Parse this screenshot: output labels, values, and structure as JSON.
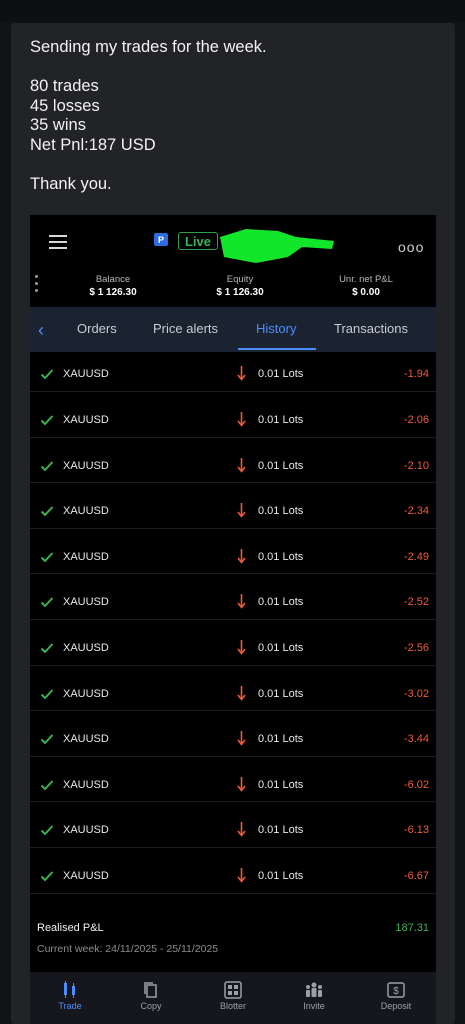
{
  "message": {
    "lines": [
      "Sending my trades for the week.",
      "",
      "80 trades",
      "45 losses",
      "35 wins",
      "Net Pnl:187 USD",
      "",
      "Thank you."
    ]
  },
  "app": {
    "live_label": "Live",
    "stats": [
      {
        "label": "Balance",
        "value": "$ 1 126.30"
      },
      {
        "label": "Equity",
        "value": "$ 1 126.30"
      },
      {
        "label": "Unr. net P&L",
        "value": "$ 0.00"
      }
    ],
    "tabs": [
      "Orders",
      "Price alerts",
      "History",
      "Transactions"
    ],
    "active_tab": "History",
    "trades": [
      {
        "symbol": "XAUUSD",
        "lots": "0.01 Lots",
        "pnl": "-1.94"
      },
      {
        "symbol": "XAUUSD",
        "lots": "0.01 Lots",
        "pnl": "-2.06"
      },
      {
        "symbol": "XAUUSD",
        "lots": "0.01 Lots",
        "pnl": "-2.10"
      },
      {
        "symbol": "XAUUSD",
        "lots": "0.01 Lots",
        "pnl": "-2.34"
      },
      {
        "symbol": "XAUUSD",
        "lots": "0.01 Lots",
        "pnl": "-2.49"
      },
      {
        "symbol": "XAUUSD",
        "lots": "0.01 Lots",
        "pnl": "-2.52"
      },
      {
        "symbol": "XAUUSD",
        "lots": "0.01 Lots",
        "pnl": "-2.56"
      },
      {
        "symbol": "XAUUSD",
        "lots": "0.01 Lots",
        "pnl": "-3.02"
      },
      {
        "symbol": "XAUUSD",
        "lots": "0.01 Lots",
        "pnl": "-3.44"
      },
      {
        "symbol": "XAUUSD",
        "lots": "0.01 Lots",
        "pnl": "-6.02"
      },
      {
        "symbol": "XAUUSD",
        "lots": "0.01 Lots",
        "pnl": "-6.13"
      },
      {
        "symbol": "XAUUSD",
        "lots": "0.01 Lots",
        "pnl": "-6.67"
      }
    ],
    "realised_label": "Realised P&L",
    "realised_value": "187.31",
    "current_week": "Current week: 24/11/2025 - 25/11/2025",
    "nav": [
      {
        "label": "Trade",
        "icon": "trade-icon"
      },
      {
        "label": "Copy",
        "icon": "copy-icon"
      },
      {
        "label": "Blotter",
        "icon": "blotter-icon"
      },
      {
        "label": "Invite",
        "icon": "invite-icon"
      },
      {
        "label": "Deposit",
        "icon": "deposit-icon"
      }
    ],
    "colors": {
      "accent": "#4b8dff",
      "loss": "#f05a3a",
      "gain": "#3bb157",
      "check": "#3bb157"
    }
  }
}
